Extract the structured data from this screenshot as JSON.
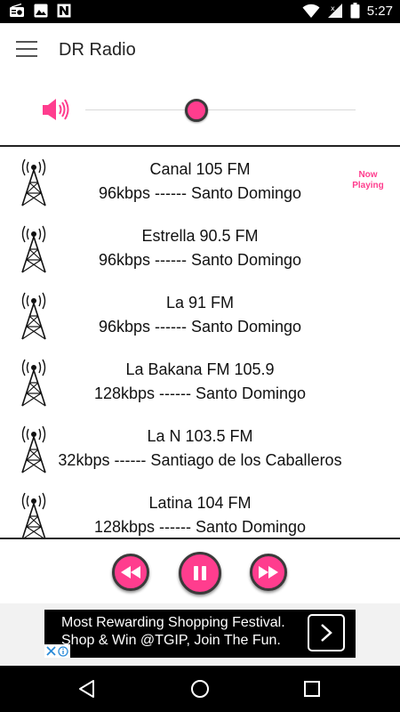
{
  "status_bar": {
    "time": "5:27"
  },
  "app_bar": {
    "title": "DR Radio"
  },
  "volume": {
    "level": 0.41
  },
  "stations": [
    {
      "name": "Canal 105 FM",
      "info": "96kbps ------ Santo Domingo",
      "now_playing": "Now Playing"
    },
    {
      "name": "Estrella 90.5 FM",
      "info": "96kbps ------ Santo Domingo"
    },
    {
      "name": "La 91 FM",
      "info": "96kbps ------ Santo Domingo"
    },
    {
      "name": "La Bakana FM 105.9",
      "info": "128kbps ------ Santo Domingo"
    },
    {
      "name": "La N 103.5 FM",
      "info": "32kbps ------ Santiago de los Caballeros"
    },
    {
      "name": "Latina 104 FM",
      "info": "128kbps ------ Santo Domingo"
    }
  ],
  "controls": {
    "rewind_icon": "rewind-icon",
    "pause_icon": "pause-icon",
    "forward_icon": "fast-forward-icon"
  },
  "ad": {
    "line1": "Most Rewarding Shopping Festival.",
    "line2": "Shop & Win @TGIP, Join The Fun."
  },
  "colors": {
    "accent": "#ff3d8e",
    "button_border": "#3a3a3a",
    "status_bar": "#000000"
  }
}
